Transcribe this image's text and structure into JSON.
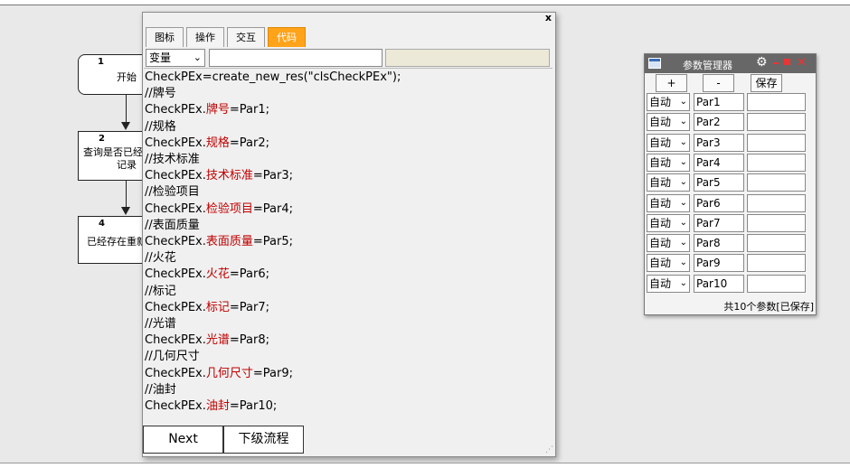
{
  "flowchart": {
    "nodes": [
      {
        "num": "1",
        "label": "开始"
      },
      {
        "num": "2",
        "label_line1": "查询是否已经",
        "label_line2": "记录"
      },
      {
        "num": "4",
        "label": "已经存在重新"
      }
    ]
  },
  "editor": {
    "close_label": "x",
    "tabs": [
      "图标",
      "操作",
      "交互",
      "代码"
    ],
    "active_tab": "代码",
    "variable_select": "变量",
    "code_lines": [
      {
        "plain": "CheckPEx=create_new_res(\"clsCheckPEx\");"
      },
      {
        "plain": "//牌号"
      },
      {
        "pre": "CheckPEx.",
        "kw": "牌号",
        "post": "=Par1;"
      },
      {
        "plain": "//规格"
      },
      {
        "pre": "CheckPEx.",
        "kw": "规格",
        "post": "=Par2;"
      },
      {
        "plain": "//技术标准"
      },
      {
        "pre": "CheckPEx.",
        "kw": "技术标准",
        "post": "=Par3;"
      },
      {
        "plain": "//检验项目"
      },
      {
        "pre": "CheckPEx.",
        "kw": "检验项目",
        "post": "=Par4;"
      },
      {
        "plain": "//表面质量"
      },
      {
        "pre": "CheckPEx.",
        "kw": "表面质量",
        "post": "=Par5;"
      },
      {
        "plain": "//火花"
      },
      {
        "pre": "CheckPEx.",
        "kw": "火花",
        "post": "=Par6;"
      },
      {
        "plain": "//标记"
      },
      {
        "pre": "CheckPEx.",
        "kw": "标记",
        "post": "=Par7;"
      },
      {
        "plain": "//光谱"
      },
      {
        "pre": "CheckPEx.",
        "kw": "光谱",
        "post": "=Par8;"
      },
      {
        "plain": "//几何尺寸"
      },
      {
        "pre": "CheckPEx.",
        "kw": "几何尺寸",
        "post": "=Par9;"
      },
      {
        "plain": "//油封"
      },
      {
        "pre": "CheckPEx.",
        "kw": "油封",
        "post": "=Par10;"
      }
    ],
    "next_label": "Next",
    "subflow_label": "下级流程"
  },
  "param_manager": {
    "title": "参数管理器",
    "add_label": "+",
    "remove_label": "-",
    "save_label": "保存",
    "mode_label": "自动",
    "params": [
      "Par1",
      "Par2",
      "Par3",
      "Par4",
      "Par5",
      "Par6",
      "Par7",
      "Par8",
      "Par9",
      "Par10"
    ],
    "status": "共10个参数[已保存]"
  },
  "colors": {
    "active_tab": "#ffa31a",
    "keyword": "#c00000",
    "titlebar": "#676767",
    "window_controls": "#ee3333"
  },
  "icons": [
    "close-icon",
    "window-icon",
    "gear-icon",
    "minimize-icon",
    "maximize-icon",
    "dropdown-arrow-icon",
    "resize-grip-icon"
  ]
}
